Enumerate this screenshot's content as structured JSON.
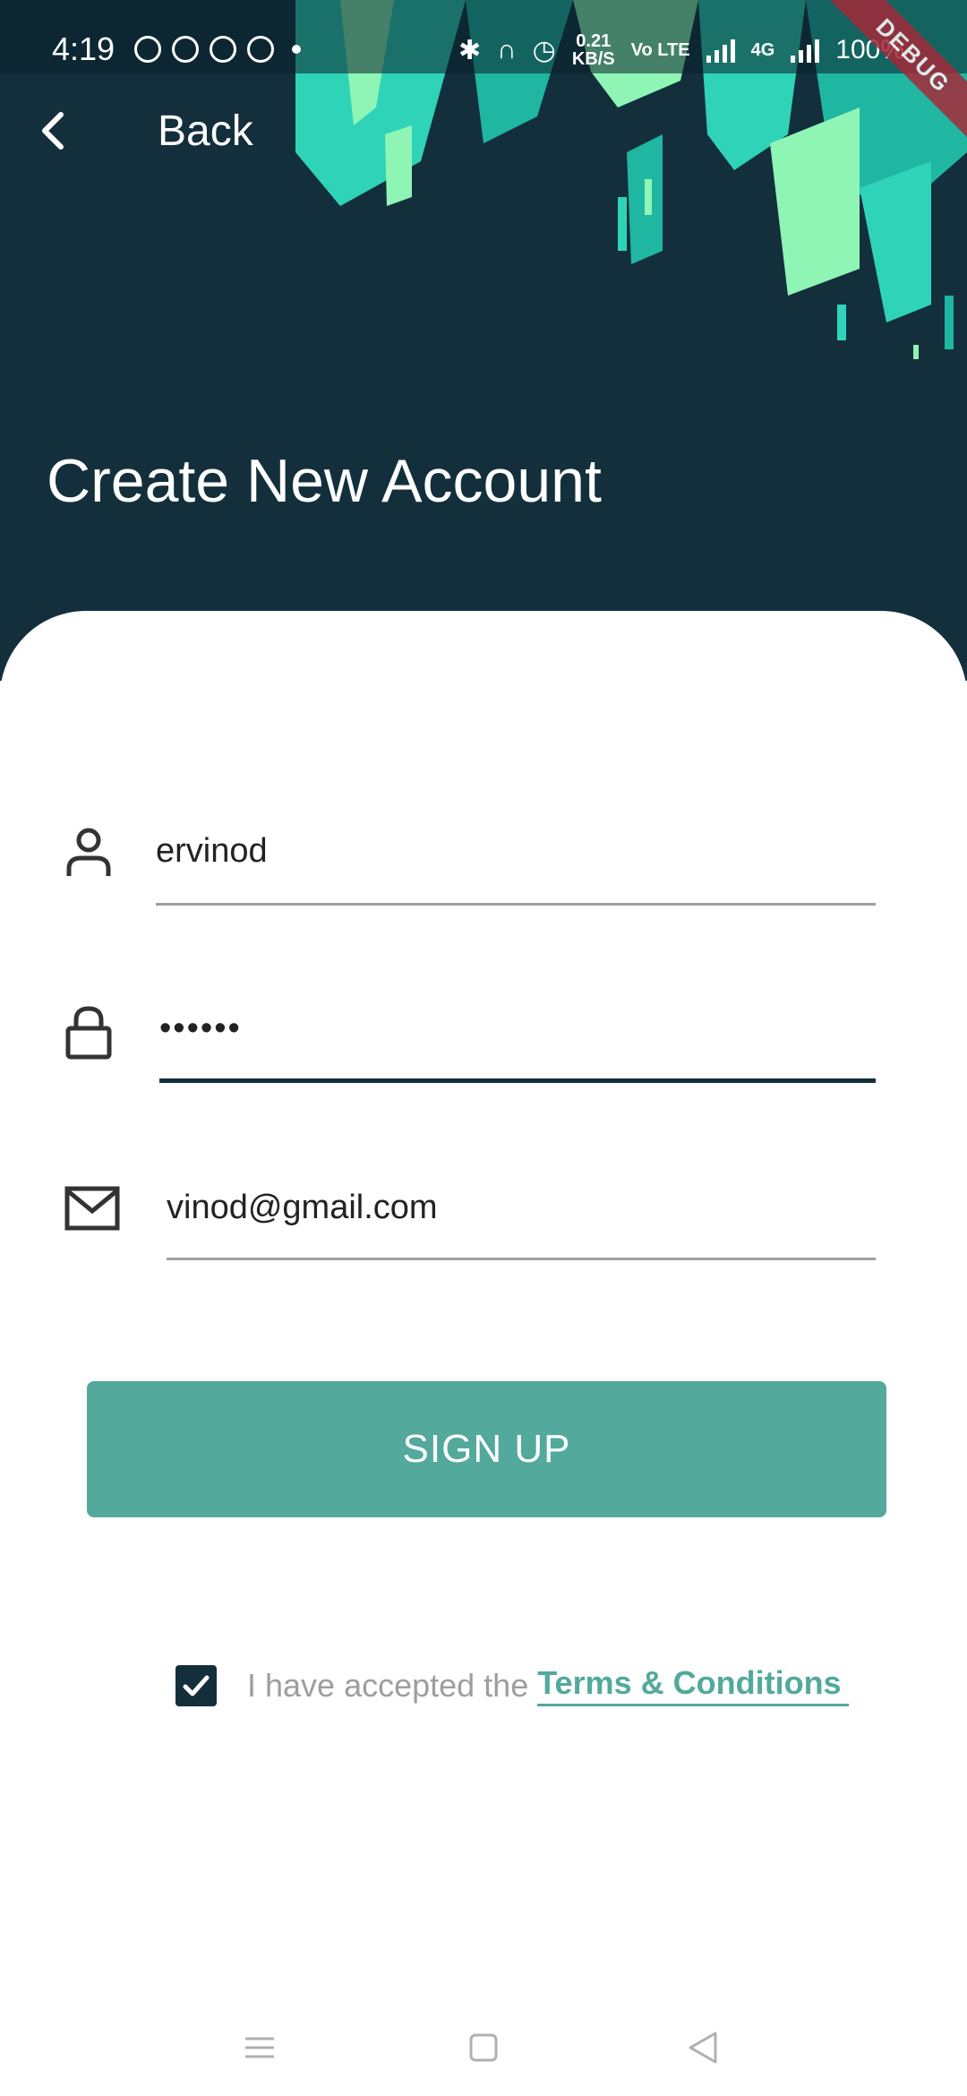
{
  "status_bar": {
    "time": "4:19",
    "speed_value": "0.21",
    "speed_unit": "KB/S",
    "volte": "Vo LTE",
    "network": "4G",
    "battery": "100%"
  },
  "debug_banner": "DEBUG",
  "header": {
    "back_label": "Back",
    "title": "Create New Account"
  },
  "form": {
    "username_value": "ervinod",
    "password_value": "••••••",
    "email_value": "vinod@gmail.com"
  },
  "signup_label": "SIGN UP",
  "terms": {
    "checked": true,
    "prefix": "I have accepted the",
    "link": "Terms & Conditions"
  },
  "colors": {
    "header_bg": "#132f3c",
    "accent": "#52a99c",
    "art_light": "#8ff5b5",
    "art_mid": "#2fd3b8"
  },
  "icons": [
    "back-arrow",
    "person",
    "lock",
    "mail",
    "check",
    "menu",
    "home-square",
    "back-triangle"
  ]
}
